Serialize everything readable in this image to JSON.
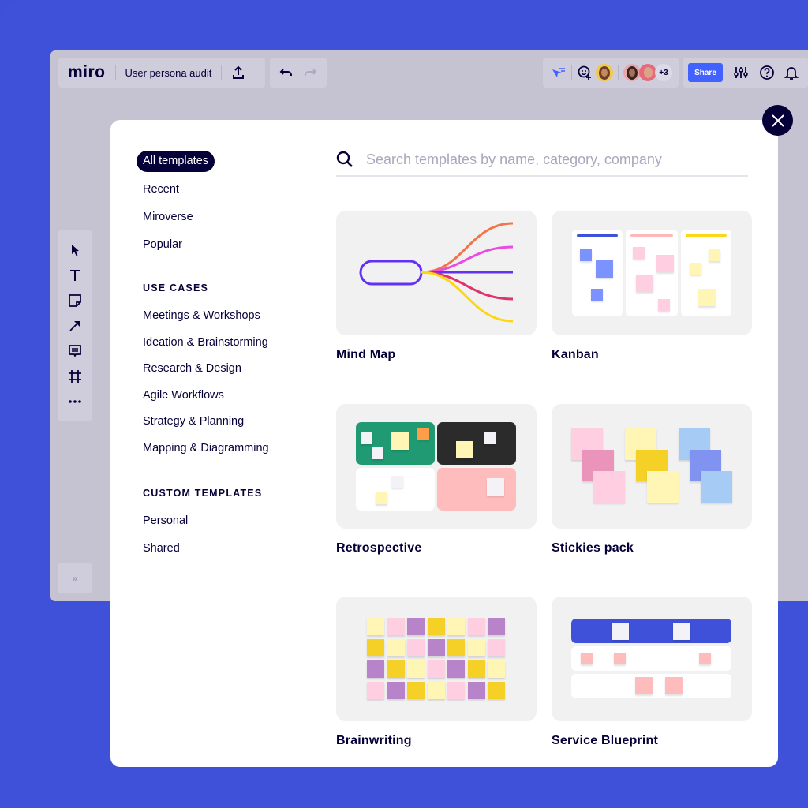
{
  "app": {
    "logo": "miro",
    "board_title": "User persona audit"
  },
  "toolbar": {
    "share_label": "Share",
    "extra_collaborators": "+3",
    "icons": [
      "upload-icon",
      "undo-icon",
      "redo-icon",
      "cursor-follow-icon",
      "add-reaction-icon",
      "settings-sliders-icon",
      "help-icon",
      "bell-icon"
    ]
  },
  "left_tools": [
    "select-icon",
    "text-icon",
    "sticky-note-icon",
    "arrow-icon",
    "comment-icon",
    "frame-icon",
    "more-icon"
  ],
  "expand_label": "»",
  "modal": {
    "search_placeholder": "Search templates by name, category, company",
    "nav": {
      "top": [
        {
          "label": "All templates",
          "active": true
        },
        {
          "label": "Recent"
        },
        {
          "label": "Miroverse"
        },
        {
          "label": "Popular"
        }
      ],
      "use_cases_heading": "USE CASES",
      "use_cases": [
        "Meetings & Workshops",
        "Ideation & Brainstorming",
        "Research & Design",
        "Agile Workflows",
        "Strategy & Planning",
        "Mapping & Diagramming"
      ],
      "custom_heading": "CUSTOM TEMPLATES",
      "custom": [
        "Personal",
        "Shared"
      ]
    },
    "templates": [
      {
        "title": "Mind Map"
      },
      {
        "title": "Kanban"
      },
      {
        "title": "Retrospective"
      },
      {
        "title": "Stickies pack"
      },
      {
        "title": "Brainwriting"
      },
      {
        "title": "Service Blueprint"
      }
    ]
  },
  "colors": {
    "brand_blue": "#4262ff",
    "dark": "#050038",
    "background": "#3f51d8"
  }
}
